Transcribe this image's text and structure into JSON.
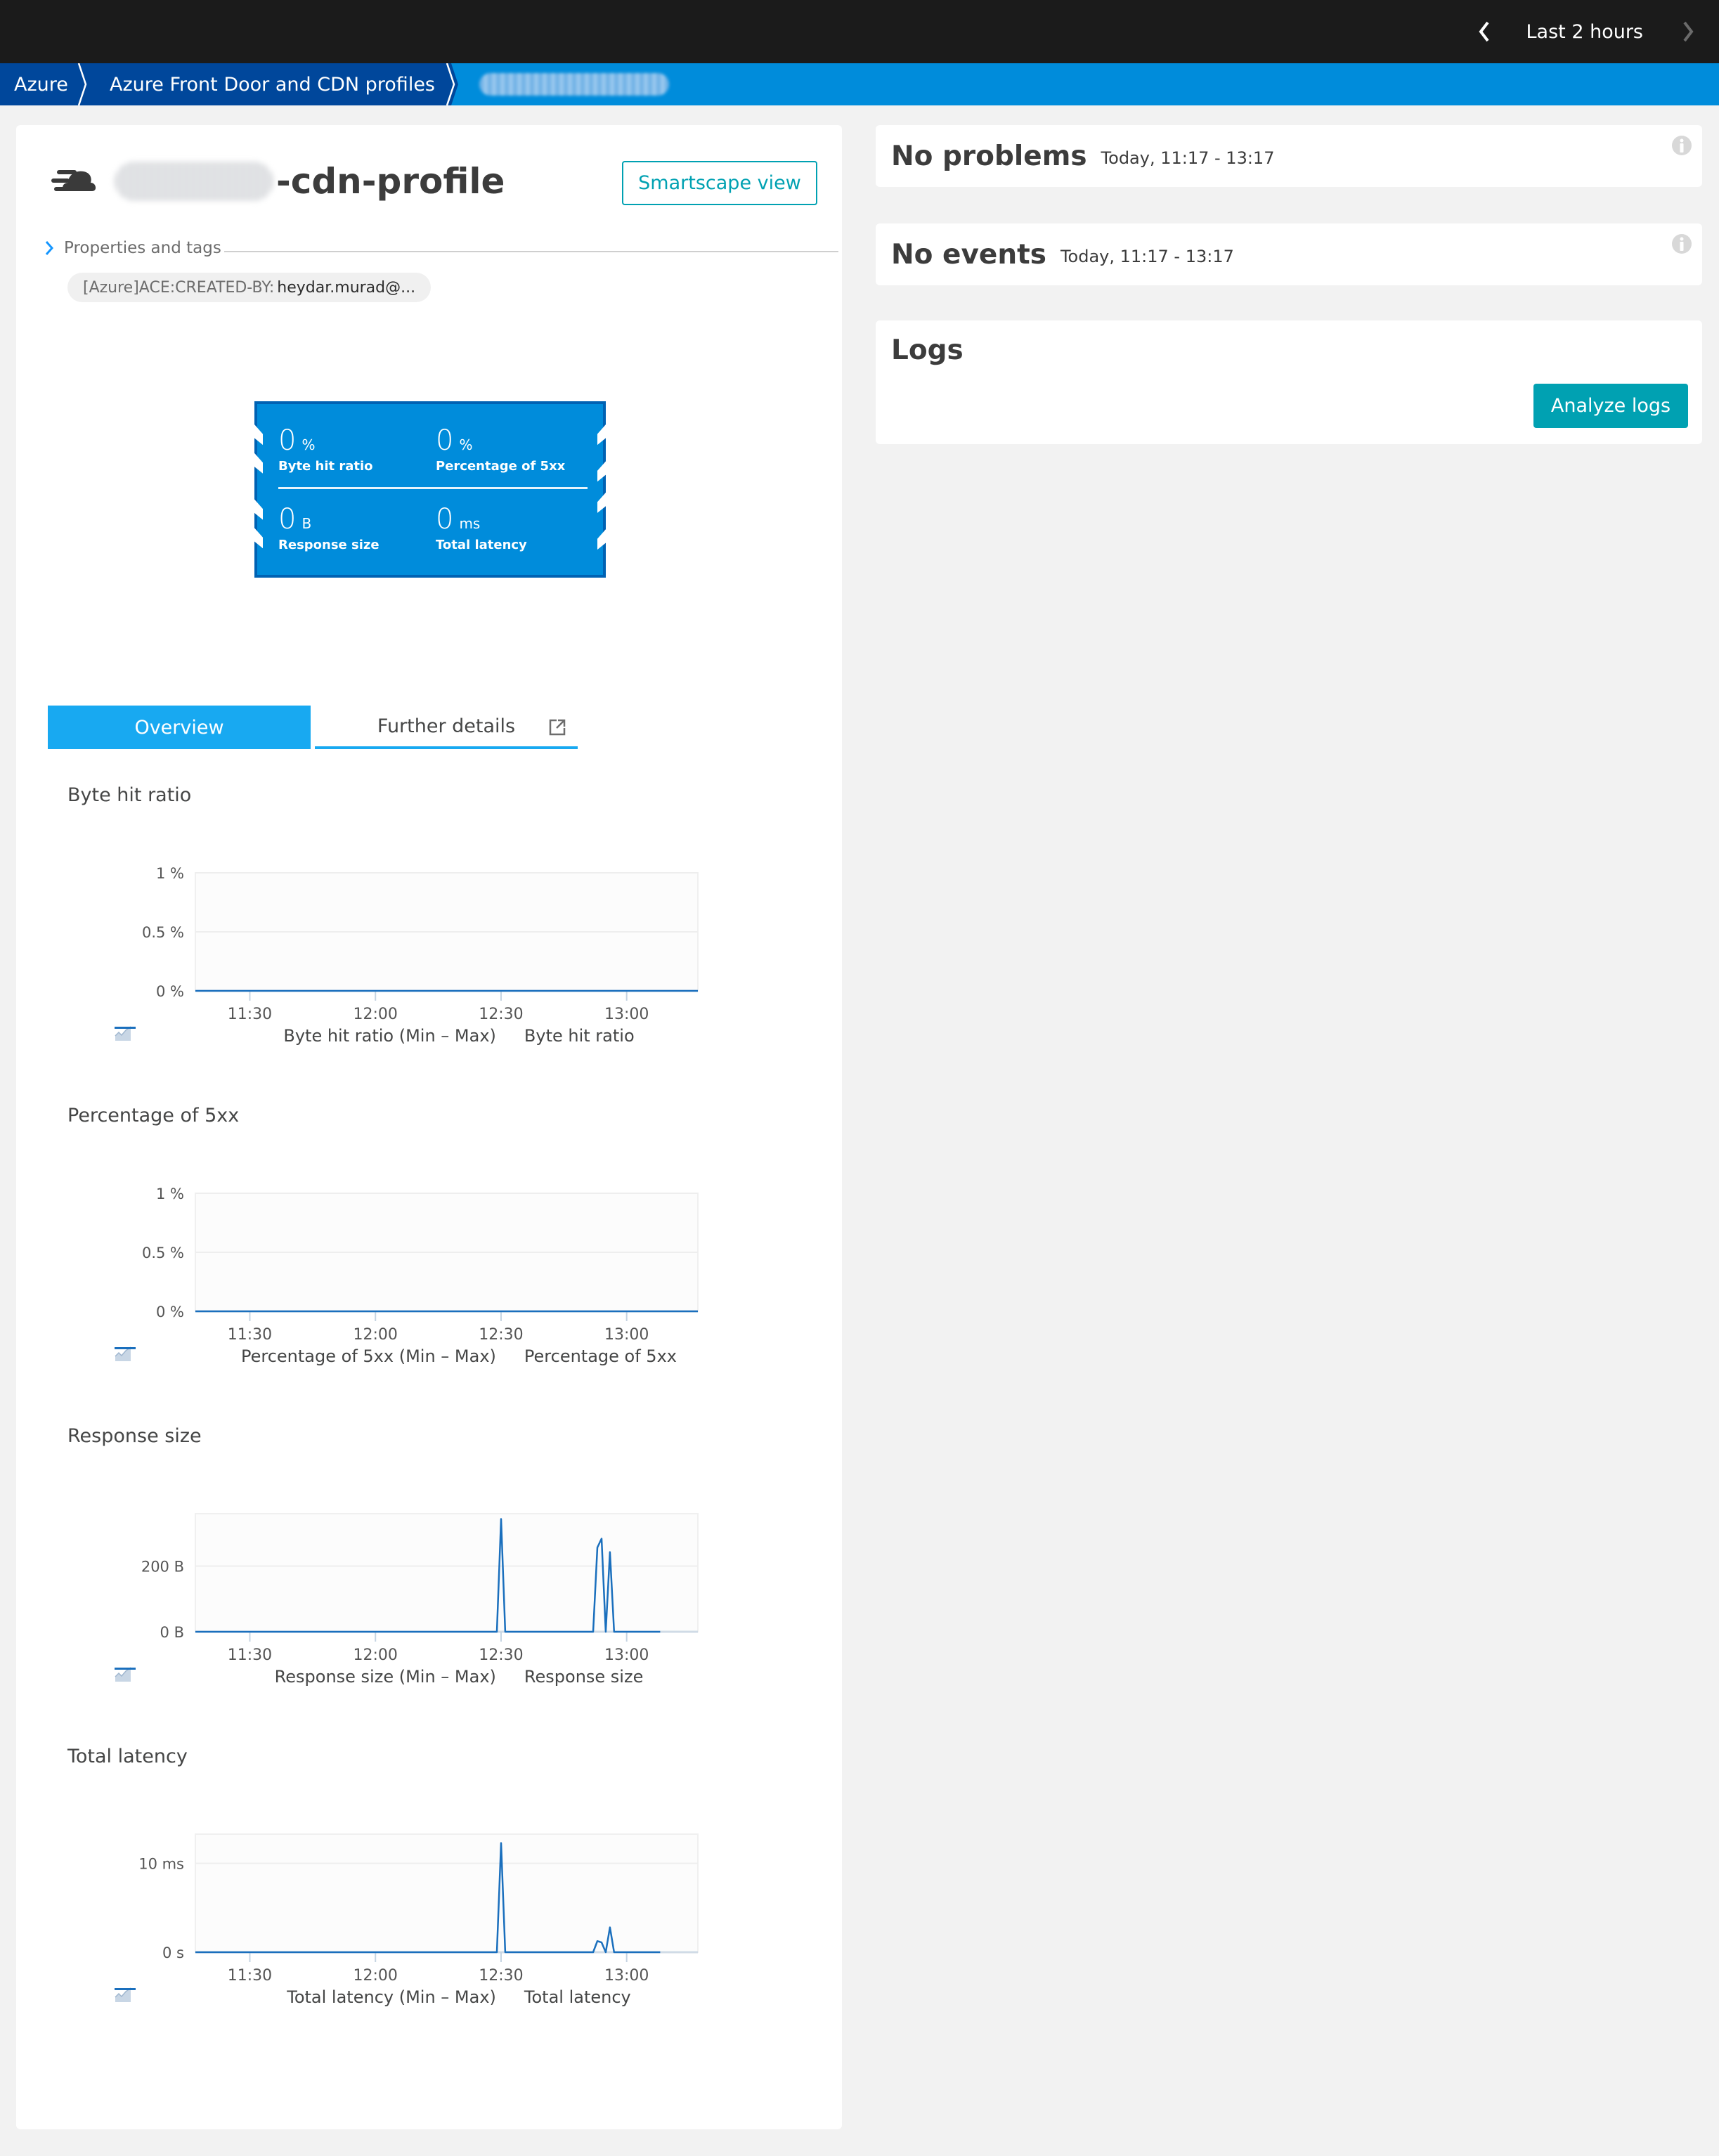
{
  "topbar": {
    "timeframe_label": "Last 2 hours",
    "prev_icon": "chevron-left-icon",
    "next_icon": "chevron-right-icon"
  },
  "breadcrumb": [
    {
      "label": "Azure"
    },
    {
      "label": "Azure Front Door and CDN profiles"
    },
    {
      "label": "[redacted]-cdn-profile",
      "redacted": true
    }
  ],
  "entity": {
    "icon": "cdn-cloud-icon",
    "title_suffix": "-cdn-profile",
    "title_prefix_redacted": true,
    "smartscape_label": "Smartscape view",
    "properties_label": "Properties and tags",
    "tag": {
      "key": "[Azure]ACE:CREATED-BY:",
      "value": "heydar.murad@..."
    }
  },
  "tile": {
    "metrics": [
      {
        "value": "0",
        "unit": "%",
        "label": "Byte hit ratio"
      },
      {
        "value": "0",
        "unit": "%",
        "label": "Percentage of 5xx"
      },
      {
        "value": "0",
        "unit": "B",
        "label": "Response size"
      },
      {
        "value": "0",
        "unit": "ms",
        "label": "Total latency"
      }
    ]
  },
  "tabs": [
    {
      "label": "Overview",
      "active": true
    },
    {
      "label": "Further details",
      "active": false,
      "icon": "external-link-icon"
    }
  ],
  "colors": {
    "accent": "#008cdb",
    "breadcrumb_dark": "#00479b",
    "tab_active": "#18a9f1",
    "teal_button": "#00a1b2",
    "series_line": "#1a6fbd",
    "range_area": "#c8d6e5"
  },
  "chart_data": [
    {
      "type": "line",
      "title": "Byte hit ratio",
      "x_range": [
        "11:17",
        "13:17"
      ],
      "x_ticks": [
        "11:30",
        "12:00",
        "12:30",
        "13:00"
      ],
      "y_ticks": [
        "0 %",
        "0.5 %",
        "1 %"
      ],
      "ylim": [
        0,
        1
      ],
      "unit": "%",
      "legend": [
        "Byte hit ratio (Min – Max)",
        "Byte hit ratio"
      ],
      "series": [
        {
          "name": "Byte hit ratio",
          "points": [
            [
              "11:17",
              0
            ],
            [
              "13:17",
              0
            ]
          ]
        }
      ]
    },
    {
      "type": "line",
      "title": "Percentage of 5xx",
      "x_range": [
        "11:17",
        "13:17"
      ],
      "x_ticks": [
        "11:30",
        "12:00",
        "12:30",
        "13:00"
      ],
      "y_ticks": [
        "0 %",
        "0.5 %",
        "1 %"
      ],
      "ylim": [
        0,
        1
      ],
      "unit": "%",
      "legend": [
        "Percentage of 5xx (Min – Max)",
        "Percentage of 5xx"
      ],
      "series": [
        {
          "name": "Percentage of 5xx",
          "points": [
            [
              "11:17",
              0
            ],
            [
              "13:17",
              0
            ]
          ]
        }
      ]
    },
    {
      "type": "line",
      "title": "Response size",
      "x_range": [
        "11:17",
        "13:17"
      ],
      "x_ticks": [
        "11:30",
        "12:00",
        "12:30",
        "13:00"
      ],
      "y_ticks": [
        "0 B",
        "200 B"
      ],
      "ylim": [
        0,
        360
      ],
      "y_tick_values": [
        0,
        200
      ],
      "unit": "B",
      "legend": [
        "Response size (Min – Max)",
        "Response size"
      ],
      "series": [
        {
          "name": "Response size",
          "points": [
            [
              "11:17",
              0
            ],
            [
              "12:29",
              0
            ],
            [
              "12:30",
              344
            ],
            [
              "12:31",
              0
            ],
            [
              "12:52",
              0
            ],
            [
              "12:53",
              257
            ],
            [
              "12:54",
              284
            ],
            [
              "12:55",
              0
            ],
            [
              "12:56",
              243
            ],
            [
              "12:57",
              0
            ],
            [
              "13:08",
              0
            ]
          ]
        }
      ]
    },
    {
      "type": "line",
      "title": "Total latency",
      "x_range": [
        "11:17",
        "13:17"
      ],
      "x_ticks": [
        "11:30",
        "12:00",
        "12:30",
        "13:00"
      ],
      "y_ticks": [
        "0 s",
        "10 ms"
      ],
      "ylim": [
        0,
        13.3
      ],
      "y_tick_values": [
        0,
        10
      ],
      "unit": "ms",
      "legend": [
        "Total latency (Min – Max)",
        "Total latency"
      ],
      "series": [
        {
          "name": "Total latency",
          "points": [
            [
              "11:17",
              0
            ],
            [
              "12:29",
              0
            ],
            [
              "12:30",
              12.3
            ],
            [
              "12:31",
              0
            ],
            [
              "12:52",
              0
            ],
            [
              "12:53",
              1.25
            ],
            [
              "12:54",
              1.1
            ],
            [
              "12:55",
              0
            ],
            [
              "12:56",
              2.8
            ],
            [
              "12:57",
              0
            ],
            [
              "13:08",
              0
            ]
          ]
        }
      ]
    }
  ],
  "right": {
    "problems": {
      "title": "No problems",
      "range": "Today, 11:17 - 13:17",
      "icon": "info-icon"
    },
    "events": {
      "title": "No events",
      "range": "Today, 11:17 - 13:17",
      "icon": "info-icon"
    },
    "logs": {
      "title": "Logs",
      "button_label": "Analyze logs"
    }
  }
}
